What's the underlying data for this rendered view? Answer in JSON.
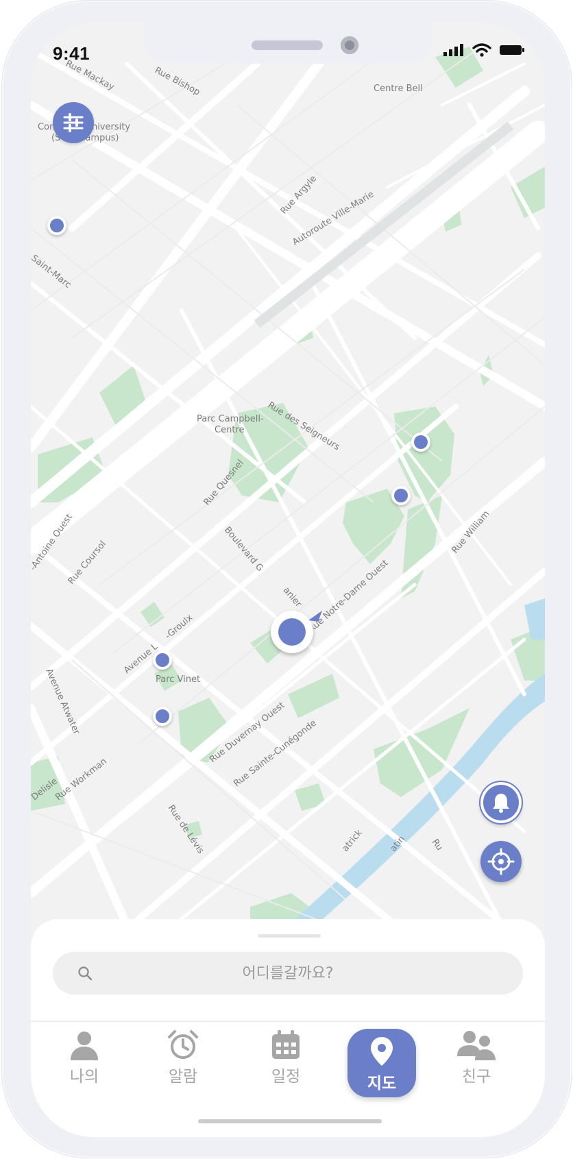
{
  "status_bar": {
    "time": "9:41"
  },
  "map": {
    "labels": [
      "Rue Mackay",
      "Rue Bishop",
      "Centre Bell",
      "Concordia University",
      "(SGW Campus)",
      "Rue Argyle",
      "Autoroute Ville-Marie",
      "Saint-Marc",
      "Parc Campbell-",
      "Centre",
      "Rue des Seigneurs",
      "Rue Quesnel",
      "Boulevard G",
      "anier",
      "Rue Notre-Dame Ouest",
      "Rue William",
      "-Antoine Ouest",
      "Rue Coursol",
      "Avenue L",
      "-Groulx",
      "Parc Vinet",
      "Avenue Atwater",
      "Rue Duvernay Ouest",
      "Rue Sainte-Cunégonde",
      "Delisle",
      "Rue Workman",
      "Rue de Lévis",
      "atrick",
      "atin",
      "Ru"
    ]
  },
  "search": {
    "placeholder": "어디를갈까요?"
  },
  "tabs": [
    {
      "label": "나의",
      "icon": "person-icon"
    },
    {
      "label": "알람",
      "icon": "alarm-clock-icon"
    },
    {
      "label": "일정",
      "icon": "calendar-icon"
    },
    {
      "label": "지도",
      "icon": "map-pin-icon",
      "active": true
    },
    {
      "label": "친구",
      "icon": "friends-icon"
    }
  ],
  "colors": {
    "accent": "#6b7fc9",
    "park": "#c8e6cc",
    "water": "#b9dcef",
    "road": "#ffffff",
    "land": "#f2f2f2"
  }
}
